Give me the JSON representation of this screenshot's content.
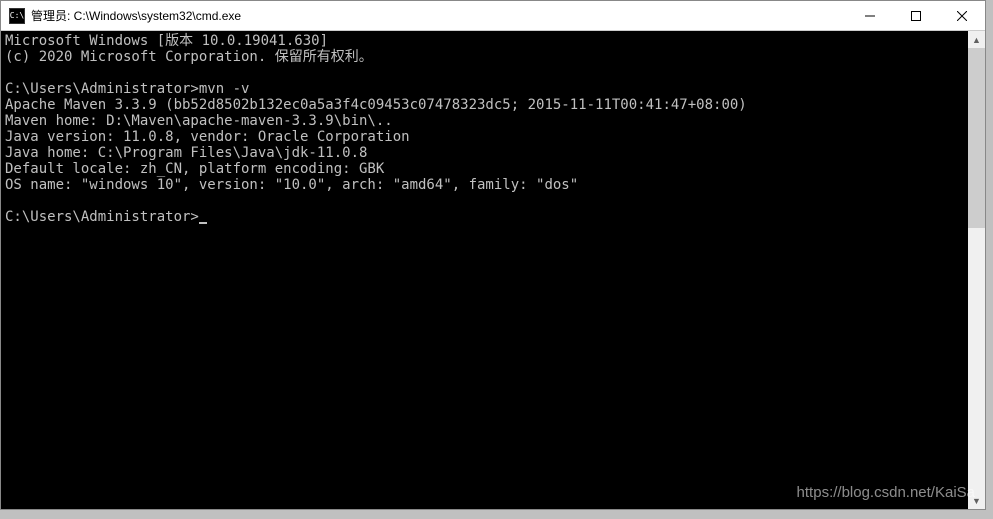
{
  "titlebar": {
    "icon_text": "C:\\",
    "title": "管理员: C:\\Windows\\system32\\cmd.exe"
  },
  "console": {
    "lines": [
      "Microsoft Windows [版本 10.0.19041.630]",
      "(c) 2020 Microsoft Corporation. 保留所有权利。",
      "",
      "C:\\Users\\Administrator>mvn -v",
      "Apache Maven 3.3.9 (bb52d8502b132ec0a5a3f4c09453c07478323dc5; 2015-11-11T00:41:47+08:00)",
      "Maven home: D:\\Maven\\apache-maven-3.3.9\\bin\\..",
      "Java version: 11.0.8, vendor: Oracle Corporation",
      "Java home: C:\\Program Files\\Java\\jdk-11.0.8",
      "Default locale: zh_CN, platform encoding: GBK",
      "OS name: \"windows 10\", version: \"10.0\", arch: \"amd64\", family: \"dos\"",
      "",
      "C:\\Users\\Administrator>"
    ]
  },
  "watermark": "https://blog.csdn.net/KaiSa"
}
